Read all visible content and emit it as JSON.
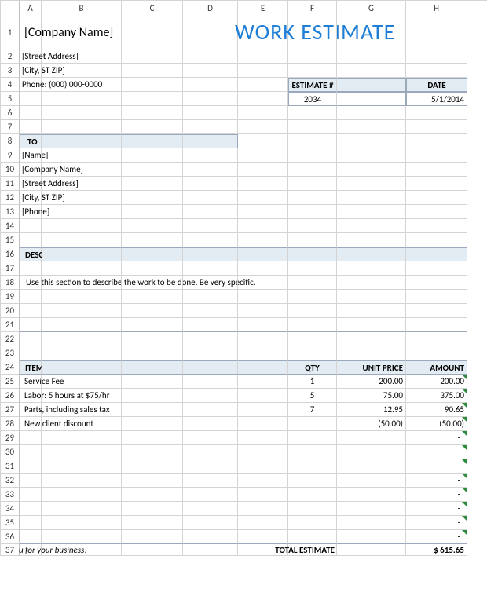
{
  "columns": [
    "A",
    "B",
    "C",
    "D",
    "E",
    "F",
    "G",
    "H"
  ],
  "rows": [
    "1",
    "2",
    "3",
    "4",
    "5",
    "6",
    "7",
    "8",
    "9",
    "10",
    "11",
    "12",
    "13",
    "14",
    "15",
    "16",
    "17",
    "18",
    "19",
    "20",
    "21",
    "22",
    "23",
    "24",
    "25",
    "26",
    "27",
    "28",
    "29",
    "30",
    "31",
    "32",
    "33",
    "34",
    "35",
    "36",
    "37"
  ],
  "header": {
    "company": "[Company Name]",
    "street": "[Street Address]",
    "city": "[City, ST  ZIP]",
    "phone": "Phone: (000) 000-0000",
    "title": "WORK ESTIMATE",
    "estimate_label": "ESTIMATE #",
    "date_label": "DATE",
    "estimate_num": "2034",
    "date": "5/1/2014"
  },
  "to": {
    "label": "TO",
    "name": "[Name]",
    "company": "[Company Name]",
    "street": "[Street Address]",
    "city": "[City, ST  ZIP]",
    "phone": "[Phone]"
  },
  "desc": {
    "label": "DESCRIPTION OF WORK",
    "text": "Use this section to describe the work to be done. Be very specific."
  },
  "items": {
    "header": {
      "label": "ITEMIZED COSTS",
      "qty": "QTY",
      "unit": "UNIT PRICE",
      "amount": "AMOUNT"
    },
    "rows": [
      {
        "desc": "Service Fee",
        "qty": "1",
        "unit": "200.00",
        "amount": "200.00"
      },
      {
        "desc": "Labor: 5 hours at $75/hr",
        "qty": "5",
        "unit": "75.00",
        "amount": "375.00"
      },
      {
        "desc": "Parts, including sales tax",
        "qty": "7",
        "unit": "12.95",
        "amount": "90.65"
      },
      {
        "desc": "New client discount",
        "qty": "",
        "unit": "(50.00)",
        "amount": "(50.00)"
      }
    ],
    "empty": [
      "-",
      "-",
      "-",
      "-",
      "-",
      "-",
      "-",
      "-"
    ]
  },
  "footer": {
    "thanks": "u for your business!",
    "total_label": "TOTAL ESTIMATE",
    "total": "$   615.65"
  }
}
